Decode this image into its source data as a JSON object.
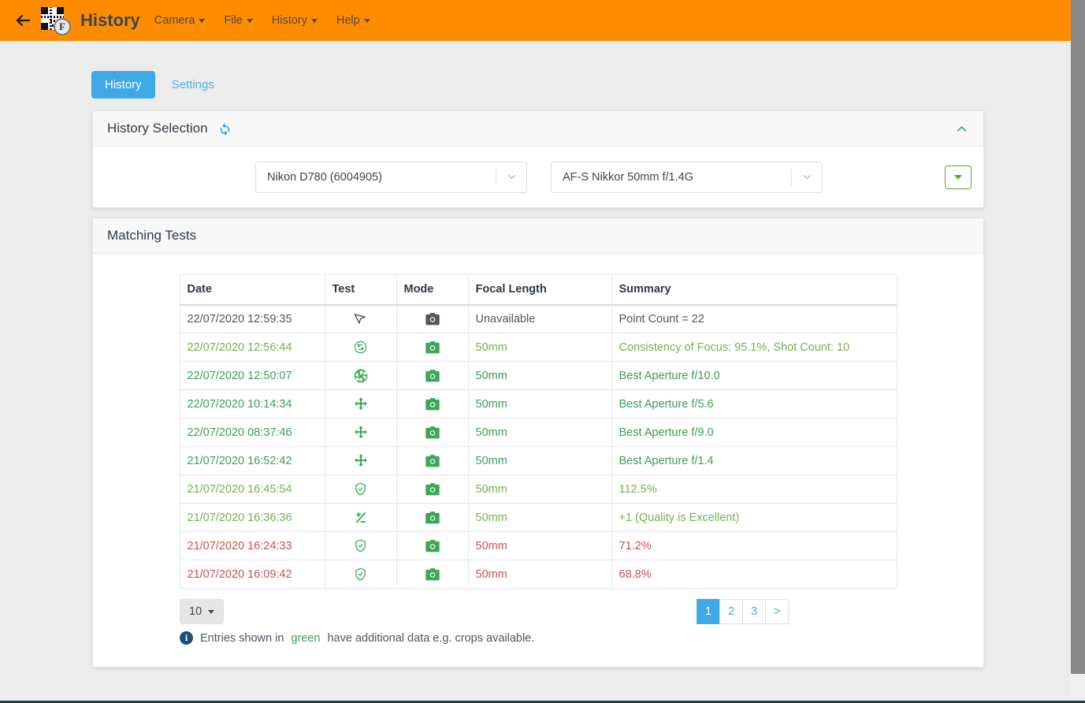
{
  "navbar": {
    "back_icon": "arrow-left-icon",
    "logo_icon": "qr-code-logo-icon",
    "logo_badge": "F",
    "title": "History",
    "menu": [
      {
        "label": "Camera"
      },
      {
        "label": "File"
      },
      {
        "label": "History"
      },
      {
        "label": "Help"
      }
    ]
  },
  "tabs": [
    {
      "label": "History",
      "active": true
    },
    {
      "label": "Settings",
      "active": false
    }
  ],
  "history_selection": {
    "title": "History Selection",
    "refresh_icon": "refresh-icon",
    "collapse_icon": "chevron-up-icon",
    "camera_select": {
      "value": "Nikon D780 (6004905)"
    },
    "lens_select": {
      "value": "AF-S Nikkor 50mm f/1.4G"
    },
    "extra_button_icon": "caret-down-icon"
  },
  "matching_tests": {
    "title": "Matching Tests",
    "columns": [
      "Date",
      "Test",
      "Mode",
      "Focal Length",
      "Summary"
    ],
    "rows": [
      {
        "date": "22/07/2020 12:59:35",
        "test_icon": "cursor-arrow-icon",
        "mode_icon": "camera-icon",
        "mode_color": "#4e5862",
        "focal": "Unavailable",
        "summary": "Point Count = 22",
        "tone": "dark"
      },
      {
        "date": "22/07/2020 12:56:44",
        "test_icon": "sync-circle-icon",
        "mode_icon": "camera-icon",
        "mode_color": "#3aa856",
        "focal": "50mm",
        "summary": "Consistency of Focus: 95.1%, Shot Count: 10",
        "tone": "green-lt"
      },
      {
        "date": "22/07/2020 12:50:07",
        "test_icon": "aperture-icon",
        "mode_icon": "camera-icon",
        "mode_color": "#3aa856",
        "focal": "50mm",
        "summary": "Best Aperture f/10.0",
        "tone": "green"
      },
      {
        "date": "22/07/2020 10:14:34",
        "test_icon": "arrows-move-icon",
        "mode_icon": "camera-icon",
        "mode_color": "#3aa856",
        "focal": "50mm",
        "summary": "Best Aperture f/5.6",
        "tone": "green"
      },
      {
        "date": "22/07/2020 08:37:46",
        "test_icon": "arrows-move-icon",
        "mode_icon": "camera-icon",
        "mode_color": "#3aa856",
        "focal": "50mm",
        "summary": "Best Aperture f/9.0",
        "tone": "green"
      },
      {
        "date": "21/07/2020 16:52:42",
        "test_icon": "arrows-move-icon",
        "mode_icon": "camera-icon",
        "mode_color": "#3aa856",
        "focal": "50mm",
        "summary": "Best Aperture f/1.4",
        "tone": "green"
      },
      {
        "date": "21/07/2020 16:45:54",
        "test_icon": "shield-check-icon",
        "mode_icon": "camera-icon",
        "mode_color": "#3aa856",
        "focal": "50mm",
        "summary": "112.5%",
        "tone": "green-lt"
      },
      {
        "date": "21/07/2020 16:36:36",
        "test_icon": "plus-minus-icon",
        "mode_icon": "camera-icon",
        "mode_color": "#3aa856",
        "focal": "50mm",
        "summary": "+1 (Quality is Excellent)",
        "tone": "green-lt"
      },
      {
        "date": "21/07/2020 16:24:33",
        "test_icon": "shield-check-icon",
        "mode_icon": "camera-icon",
        "mode_color": "#3aa856",
        "focal": "50mm",
        "summary": "71.2%",
        "tone": "red"
      },
      {
        "date": "21/07/2020 16:09:42",
        "test_icon": "shield-check-icon",
        "mode_icon": "camera-icon",
        "mode_color": "#3aa856",
        "focal": "50mm",
        "summary": "68.8%",
        "tone": "red"
      }
    ],
    "page_size": "10",
    "page_size_caret": "caret-down-icon",
    "pager": [
      {
        "label": "1",
        "active": true
      },
      {
        "label": "2",
        "active": false
      },
      {
        "label": "3",
        "active": false
      },
      {
        "label": ">",
        "active": false
      }
    ],
    "legend": {
      "info_icon": "info-icon",
      "badge": "i",
      "text_before": "Entries shown in",
      "highlight": "green",
      "text_after": "have additional data e.g. crops available."
    }
  },
  "colors": {
    "navbar": "#ff8c00",
    "accent_blue": "#3fa9e8",
    "green": "#3a9f56",
    "green_light": "#76b04f",
    "red": "#c8534f",
    "button_green": "#5ea832"
  }
}
